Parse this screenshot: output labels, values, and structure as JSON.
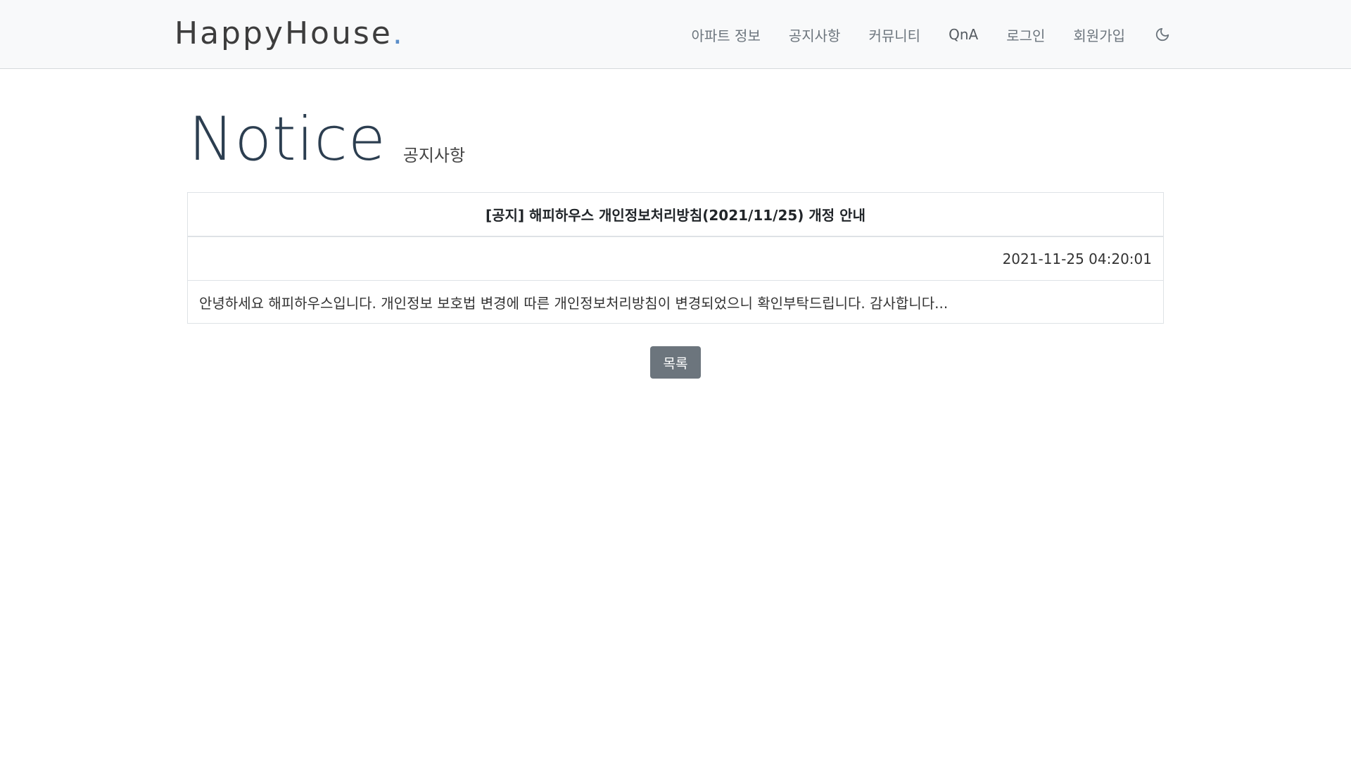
{
  "navbar": {
    "brand_text": "HappyHouse",
    "brand_dot": ".",
    "links": [
      "아파트 정보",
      "공지사항",
      "커뮤니티",
      "QnA",
      "로그인",
      "회원가입"
    ],
    "theme_icon": "moon-icon"
  },
  "page": {
    "title": "Notice",
    "subtitle": "공지사항"
  },
  "notice": {
    "title": "[공지] 해피하우스 개인정보처리방침(2021/11/25) 개정 안내",
    "date": "2021-11-25 04:20:01",
    "content": "안녕하세요 해피하우스입니다. 개인정보 보호법 변경에 따른 개인정보처리방침이 변경되었으니 확인부탁드립니다. 감사합니다..."
  },
  "actions": {
    "list_button": "목록"
  },
  "colors": {
    "navbar_bg": "#f8f9fa",
    "brand_dot": "#5b8ec9",
    "button_bg": "#6c757d",
    "title_color": "#2c3e50"
  }
}
